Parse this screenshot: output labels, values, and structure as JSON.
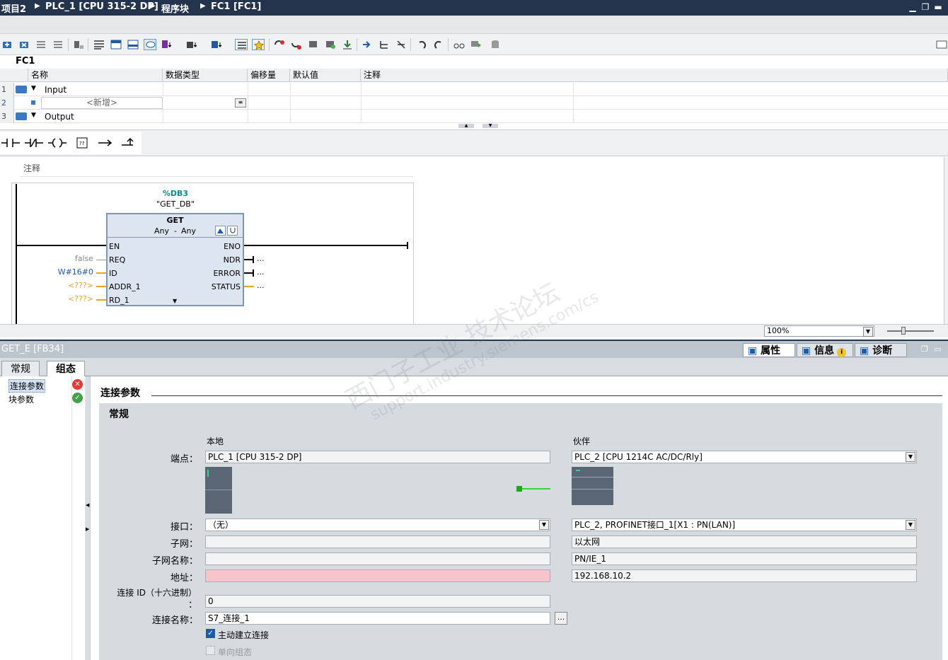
{
  "breadcrumb": [
    "项目2",
    "PLC_1 [CPU 315-2 DP]",
    "程序块",
    "FC1 [FC1]"
  ],
  "window_buttons": [
    "minimize-icon",
    "restore-icon",
    "close-icon"
  ],
  "block_title": "FC1",
  "interface": {
    "columns": [
      "名称",
      "数据类型",
      "偏移量",
      "默认值",
      "注释"
    ],
    "rows": [
      {
        "num": "1",
        "name": "Input"
      },
      {
        "num": "2",
        "name": "<新增>"
      },
      {
        "num": "3",
        "name": "Output"
      }
    ]
  },
  "network": {
    "comment": "注释",
    "db_number": "%DB3",
    "db_name": "\"GET_DB\"",
    "block_name": "GET",
    "type_left": "Any",
    "type_sep": "-",
    "type_right": "Any",
    "inputs": [
      "EN",
      "REQ",
      "ID",
      "ADDR_1",
      "RD_1"
    ],
    "outputs": [
      "ENO",
      "NDR",
      "ERROR",
      "STATUS"
    ],
    "input_values": [
      "false",
      "W#16#0",
      "<???>",
      "<???>"
    ],
    "output_values": [
      "...",
      "...",
      "..."
    ]
  },
  "zoom": "100%",
  "inspector": {
    "title": "GET_E [FB34]",
    "tabs": [
      "属性",
      "信息",
      "诊断"
    ],
    "main_tabs": [
      "常规",
      "组态"
    ],
    "nav_items": [
      "连接参数",
      "块参数"
    ],
    "section": "连接参数",
    "subsection": "常规",
    "local_header": "本地",
    "partner_header": "伙伴",
    "labels": {
      "endpoint": "端点：",
      "interface": "接口：",
      "subnet": "子网：",
      "subnet_name": "子网名称：",
      "address": "地址：",
      "conn_id": "连接 ID（十六进制）",
      "conn_id_colon": "：",
      "conn_name": "连接名称："
    },
    "local": {
      "endpoint": "PLC_1 [CPU 315-2 DP]",
      "interface": "（无）",
      "subnet": "",
      "subnet_name": "",
      "address": ""
    },
    "partner": {
      "endpoint": "PLC_2 [CPU 1214C AC/DC/Rly]",
      "interface": "PLC_2, PROFINET接口_1[X1 : PN(LAN)]",
      "subnet": "以太网",
      "subnet_name": "PN/IE_1",
      "address": "192.168.10.2"
    },
    "conn_id": "0",
    "conn_name": "S7_连接_1",
    "browse": "...",
    "active_conn": "主动建立连接",
    "oneway": "单向组态"
  },
  "watermark": [
    "西门子工业  技术论坛",
    "support.industry.siemens.com/cs"
  ],
  "colors": {
    "titlebar": "#24344d",
    "error": "#e53935",
    "ok": "#43a047",
    "highlight": "#f9c3cb"
  }
}
